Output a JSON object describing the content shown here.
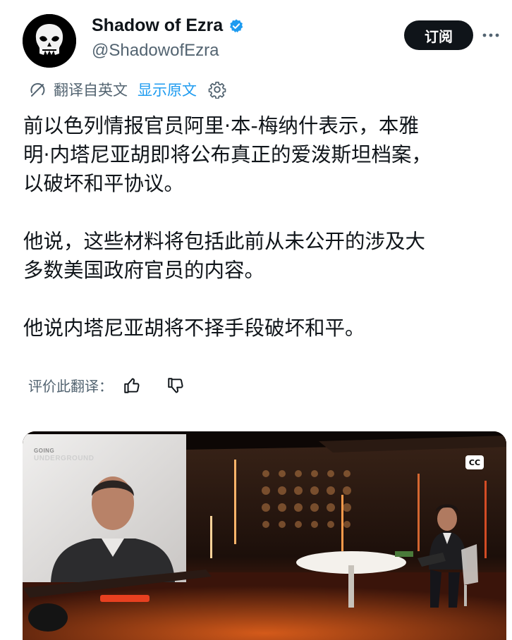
{
  "author": {
    "display_name": "Shadow of Ezra",
    "handle": "@ShadowofEzra"
  },
  "actions": {
    "subscribe_label": "订阅"
  },
  "translation": {
    "label": "翻译自英文",
    "show_original": "显示原文"
  },
  "post": {
    "paragraphs": [
      "前以色列情报官员阿里·本-梅纳什表示，本雅\n明·内塔尼亚胡即将公布真正的爱泼斯坦档案，\n以破坏和平协议。",
      "他说，这些材料将包括此前从未公开的涉及大\n多数美国政府官员的内容。",
      "他说内塔尼亚胡将不择手段破坏和平。"
    ]
  },
  "rating": {
    "label": "评价此翻译："
  },
  "media": {
    "logo_line1": "GOING",
    "logo_line2": "UNDERGROUND",
    "cc_label": "CC"
  },
  "colors": {
    "accent": "#1d9bf0",
    "secondary_text": "#536471",
    "primary_text": "#0f1419"
  }
}
